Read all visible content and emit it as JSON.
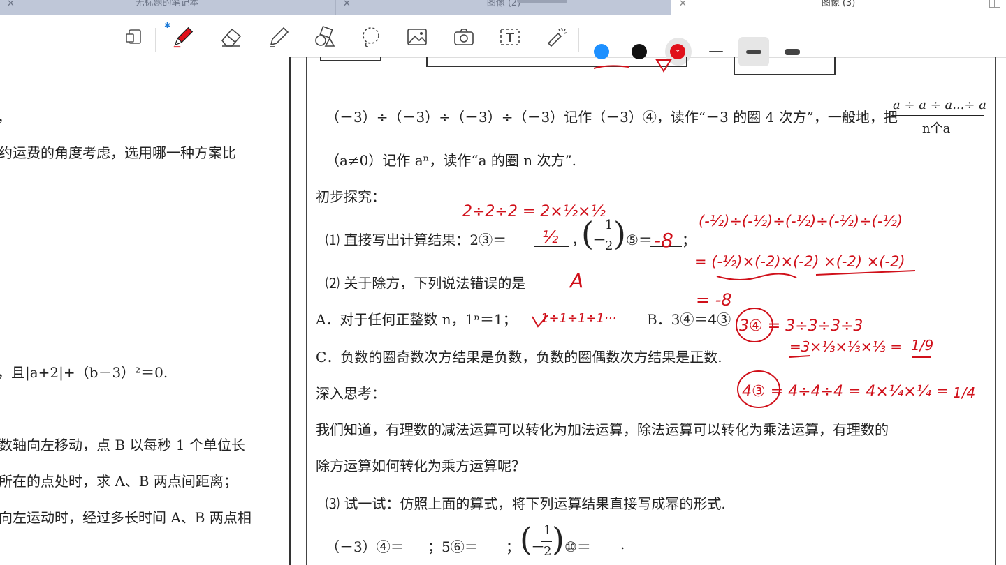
{
  "tabs": [
    {
      "label": "无标题的笔记本",
      "active": false
    },
    {
      "label": "图像 (2)",
      "active": false
    },
    {
      "label": "图像 (3)",
      "active": true
    }
  ],
  "toolbar": {
    "tools": [
      "page-layout-icon",
      "pen-icon",
      "eraser-icon",
      "highlighter-icon",
      "shapes-icon",
      "lasso-icon",
      "image-icon",
      "camera-icon",
      "text-box-icon",
      "laser-pointer-icon"
    ],
    "colors": [
      "#1e90ff",
      "#111111",
      "#e0101a"
    ],
    "selected_color": "#e0101a",
    "thickness": [
      "thin",
      "medium",
      "thick"
    ],
    "selected_thickness": "medium"
  },
  "left_page": {
    "lines": [
      "，",
      "约运费的角度考虑，选用哪一种方案比",
      "，且|a+2|+（b－3）²＝0.",
      "数轴向左移动，点 B 以每秒 1 个单位长",
      "所在的点处时，求 A、B 两点间距离；",
      "向左运动时，经过多长时间 A、B 两点相"
    ]
  },
  "main": {
    "line1": "（－3）÷（－3）÷（－3）÷（－3）记作（－3）④，读作“－3 的圈 4 次方”，一般地，把",
    "frac_num": "a ÷ a ÷ a...÷ a",
    "frac_den": "n个a",
    "line2": "（a≠0）记作 aⁿ，读作“a 的圈 n 次方”.",
    "heading1": "初步探究：",
    "q1_prefix": "⑴ 直接写出计算结果：2③＝",
    "q1_frac_num": "1",
    "q1_frac_den": "2",
    "q1_mid_sup": "⑤＝",
    "q1_end": "；",
    "q2": "⑵ 关于除方，下列说法错误的是",
    "optA": "A．对于任何正整数 n，1ⁿ＝1；",
    "optB": "B．3④＝4③",
    "optC": "C．负数的圈奇数次方结果是负数，负数的圈偶数次方结果是正数.",
    "heading2": "深入思考：",
    "para1": "我们知道，有理数的减法运算可以转化为加法运算，除法运算可以转化为乘法运算，有理数的",
    "para2": "除方运算如何转化为乘方运算呢？",
    "q3": "⑶ 试一试：仿照上面的算式，将下列运算结果直接写成幂的形式.",
    "q3_a": "（－3）④＝",
    "q3_b": "；5⑥＝",
    "q3_c": "；",
    "q3_frac_num": "1",
    "q3_frac_den": "2",
    "q3_d": "⑩＝",
    "q3_e": "."
  },
  "handwriting": {
    "hw1": "2÷2÷2 = 2×½×½",
    "hw_q1a": "½",
    "hw_q1b": "-8",
    "hw_r1": "(-½)÷(-½)÷(-½)÷(-½)÷(-½)",
    "hw_r2": "= (-½)×(-2)×(-2) ×(-2) ×(-2)",
    "hw_r3": "= -8",
    "hw_q2": "A",
    "hw_a": "1÷1÷1÷1···",
    "hw_b1": "3④ = 3÷3÷3÷3",
    "hw_b2": "=3×⅓×⅓×⅓ =",
    "hw_b2f": "1/9",
    "hw_b3": "4③ = 4÷4÷4 = 4×¼×¼ =",
    "hw_b3f": "1/4"
  }
}
